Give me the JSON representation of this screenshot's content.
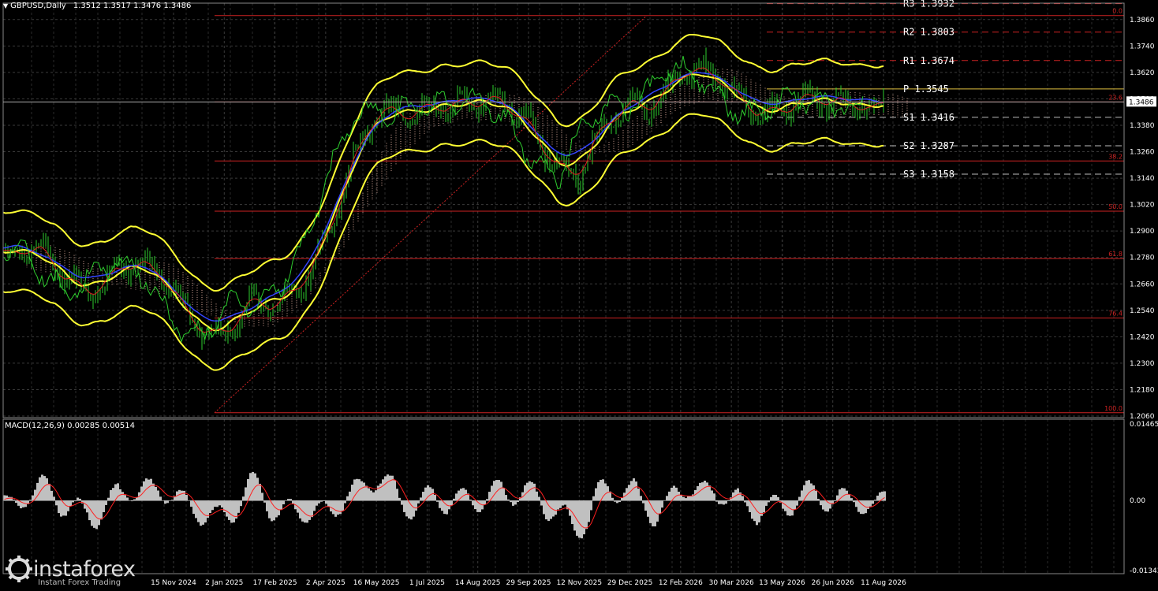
{
  "header": {
    "symbol": "GBPUSD,Daily",
    "ohlc": "1.3512 1.3517 1.3476 1.3486"
  },
  "price_axis": {
    "ticks": [
      "1.3860",
      "1.3740",
      "1.3620",
      "1.3500",
      "1.3380",
      "1.3260",
      "1.3140",
      "1.3020",
      "1.2900",
      "1.2780",
      "1.2660",
      "1.2540",
      "1.2420",
      "1.2300",
      "1.2180",
      "1.2060"
    ],
    "current_price": "1.3486"
  },
  "pivots": [
    {
      "label": "R3",
      "value": "1.3932"
    },
    {
      "label": "R2",
      "value": "1.3803"
    },
    {
      "label": "R1",
      "value": "1.3674"
    },
    {
      "label": "P",
      "value": "1.3545"
    },
    {
      "label": "S1",
      "value": "1.3416"
    },
    {
      "label": "S2",
      "value": "1.3287"
    },
    {
      "label": "S3",
      "value": "1.3158"
    }
  ],
  "fibo": [
    {
      "label": "0.0",
      "price": 1.3878
    },
    {
      "label": "23.6",
      "price": 1.3486
    },
    {
      "label": "38.2",
      "price": 1.3218
    },
    {
      "label": "50.0",
      "price": 1.299
    },
    {
      "label": "61.8",
      "price": 1.2775
    },
    {
      "label": "76.4",
      "price": 1.2505
    },
    {
      "label": "100.0",
      "price": 1.2075
    }
  ],
  "date_axis": [
    "15 Nov 2024",
    "2 Jan 2025",
    "17 Feb 2025",
    "2 Apr 2025",
    "16 May 2025",
    "1 Jul 2025",
    "14 Aug 2025",
    "29 Sep 2025",
    "12 Nov 2025",
    "29 Dec 2025",
    "12 Feb 2026",
    "30 Mar 2026",
    "13 May 2026",
    "26 Jun 2026",
    "11 Aug 2026"
  ],
  "macd": {
    "header": "MACD(12,26,9) 0.00285 0.00514",
    "ticks": [
      "0.01465",
      "0.00",
      "-0.01343"
    ]
  },
  "logo": {
    "brand": "instaforex",
    "tagline": "Instant Forex Trading"
  },
  "colors": {
    "background": "#000000",
    "grid": "#3a3a3a",
    "candle": "#2ecc2e",
    "bollinger": "#ffff33",
    "kijun": "#3344ff",
    "tenkan": "#dd2222",
    "cloud": "#d9a99a",
    "fibo": "#cc2222",
    "macd_hist": "#c0c0c0",
    "macd_signal": "#ff2020"
  },
  "chart_data": {
    "type": "line",
    "title": "GBPUSD,Daily",
    "x": [
      "15 Nov 2024",
      "2 Jan 2025",
      "17 Feb 2025",
      "2 Apr 2025",
      "16 May 2025",
      "1 Jul 2025",
      "14 Aug 2025",
      "29 Sep 2025",
      "12 Nov 2025",
      "29 Dec 2025",
      "12 Feb 2026",
      "30 Mar 2026",
      "13 May 2026",
      "26 Jun 2026",
      "11 Aug 2026"
    ],
    "series": [
      {
        "values": [
          1.265,
          1.245,
          1.252,
          1.292,
          1.335,
          1.355,
          1.342,
          1.346,
          1.311,
          1.348,
          1.362,
          1.349,
          1.352,
          1.34,
          1.356
        ]
      }
    ],
    "ylim": [
      1.206,
      1.392
    ],
    "grid": true
  }
}
